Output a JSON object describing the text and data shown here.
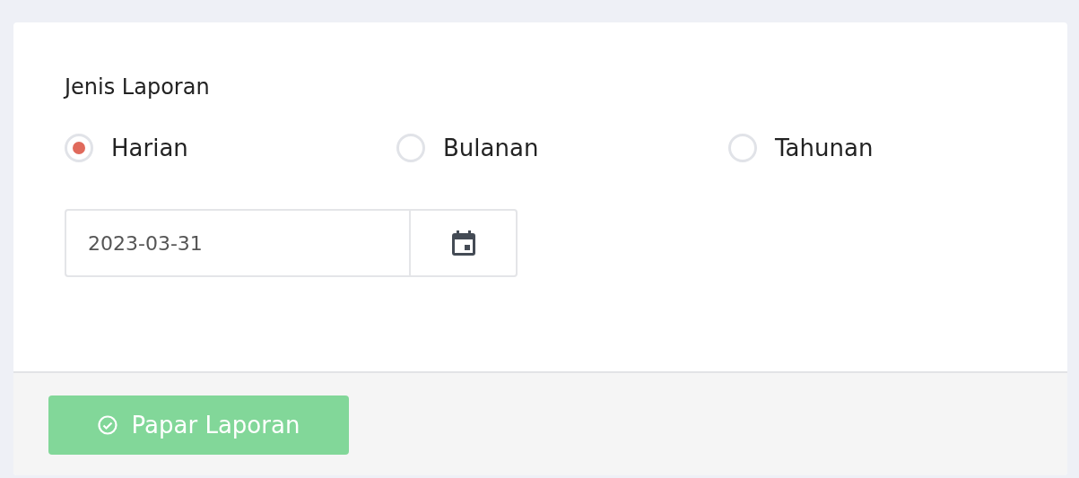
{
  "form": {
    "label": "Jenis Laporan",
    "options": [
      {
        "label": "Harian",
        "selected": true
      },
      {
        "label": "Bulanan",
        "selected": false
      },
      {
        "label": "Tahunan",
        "selected": false
      }
    ],
    "date": {
      "value": "2023-03-31"
    }
  },
  "footer": {
    "button": "Papar Laporan"
  }
}
